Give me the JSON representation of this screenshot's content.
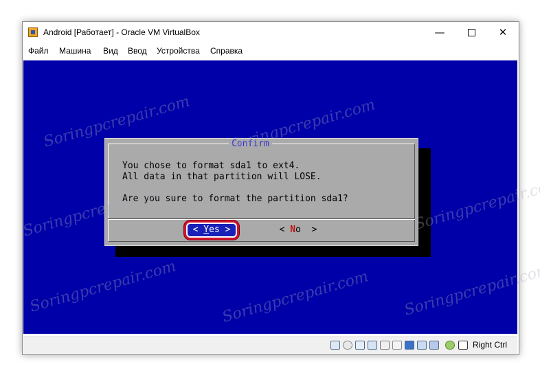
{
  "window": {
    "title": "Android [Работает] - Oracle VM VirtualBox",
    "controls": {
      "minimize": "—",
      "close": "✕"
    }
  },
  "menu": [
    "Файл",
    "Машина",
    "Вид",
    "Ввод",
    "Устройства",
    "Справка"
  ],
  "dialog": {
    "title": "Confirm",
    "lines": [
      "You chose to format sda1 to ext4.",
      "All data in that partition will LOSE.",
      "Are you sure to format the partition sda1?"
    ],
    "yes": {
      "left": "<",
      "hot": "Y",
      "rest": "es",
      "right": ">"
    },
    "no": {
      "left": "<",
      "hot": "N",
      "rest": "o",
      "right": ">"
    }
  },
  "statusbar": {
    "icons": [
      "hard-disk-icon",
      "optical-drive-icon",
      "audio-icon",
      "network-icon",
      "usb-icon",
      "shared-folders-icon",
      "display-icon",
      "video-capture-icon",
      "cpu-icon",
      "virtualization-icon",
      "mouse-integration-icon"
    ],
    "host_key": "Right Ctrl"
  },
  "watermark": "Soringpcrepair.com",
  "colors": {
    "guest_background": "#0000a8",
    "dialog_gray": "#aaaaaa",
    "highlight_ring": "#d0142c"
  }
}
